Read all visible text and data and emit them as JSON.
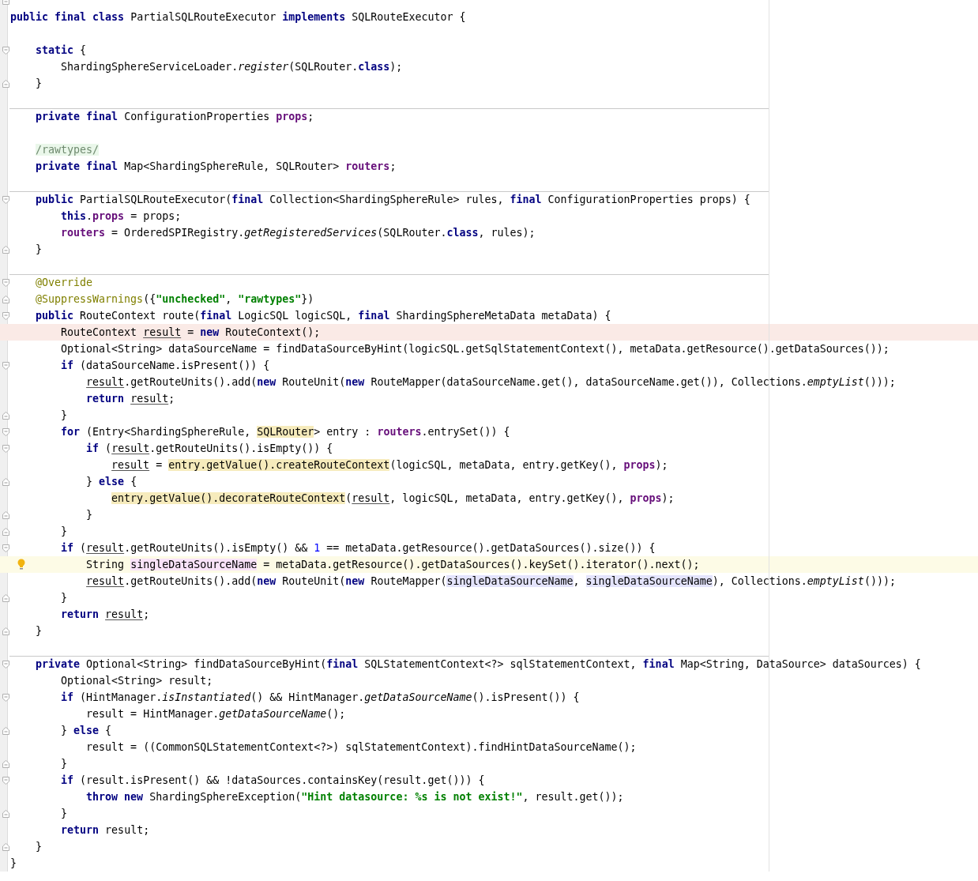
{
  "editor": {
    "lines": [
      {
        "kind": "blank",
        "fold_end": true
      },
      {
        "kind": "code",
        "tokens": [
          {
            "kind": "keyword",
            "text": "public final class"
          },
          {
            "kind": "plain",
            "text": " PartialSQLRouteExecutor "
          },
          {
            "kind": "keyword",
            "text": "implements"
          },
          {
            "kind": "plain",
            "text": " SQLRouteExecutor {"
          }
        ]
      },
      {
        "kind": "blank"
      },
      {
        "kind": "code",
        "fold_start": true,
        "tokens": [
          {
            "kind": "keyword",
            "text": "    static"
          },
          {
            "kind": "plain",
            "text": " {"
          }
        ]
      },
      {
        "kind": "code",
        "tokens": [
          {
            "kind": "plain",
            "text": "        ShardingSphereServiceLoader."
          },
          {
            "kind": "static",
            "text": "register"
          },
          {
            "kind": "plain",
            "text": "(SQLRouter."
          },
          {
            "kind": "keyword",
            "text": "class"
          },
          {
            "kind": "plain",
            "text": ");"
          }
        ]
      },
      {
        "kind": "code",
        "fold_end": true,
        "tokens": [
          {
            "kind": "plain",
            "text": "    }"
          }
        ]
      },
      {
        "kind": "blank"
      },
      {
        "kind": "code",
        "separator": true,
        "tokens": [
          {
            "kind": "keyword",
            "text": "    private final"
          },
          {
            "kind": "plain",
            "text": " ConfigurationProperties "
          },
          {
            "kind": "field",
            "text": "props"
          },
          {
            "kind": "plain",
            "text": ";"
          }
        ]
      },
      {
        "kind": "blank"
      },
      {
        "kind": "code",
        "tokens": [
          {
            "kind": "comment",
            "text": "    /rawtypes/"
          }
        ]
      },
      {
        "kind": "code",
        "tokens": [
          {
            "kind": "keyword",
            "text": "    private final"
          },
          {
            "kind": "plain",
            "text": " Map<ShardingSphereRule, SQLRouter> "
          },
          {
            "kind": "field",
            "text": "routers"
          },
          {
            "kind": "plain",
            "text": ";"
          }
        ]
      },
      {
        "kind": "blank"
      },
      {
        "kind": "code",
        "separator": true,
        "fold_start": true,
        "tokens": [
          {
            "kind": "keyword",
            "text": "    public"
          },
          {
            "kind": "plain",
            "text": " PartialSQLRouteExecutor("
          },
          {
            "kind": "keyword",
            "text": "final"
          },
          {
            "kind": "plain",
            "text": " Collection<ShardingSphereRule> rules, "
          },
          {
            "kind": "keyword",
            "text": "final"
          },
          {
            "kind": "plain",
            "text": " ConfigurationProperties props) {"
          }
        ]
      },
      {
        "kind": "code",
        "tokens": [
          {
            "kind": "keyword",
            "text": "        this"
          },
          {
            "kind": "plain",
            "text": "."
          },
          {
            "kind": "field",
            "text": "props"
          },
          {
            "kind": "plain",
            "text": " = props;"
          }
        ]
      },
      {
        "kind": "code",
        "tokens": [
          {
            "kind": "field",
            "text": "        routers"
          },
          {
            "kind": "plain",
            "text": " = OrderedSPIRegistry."
          },
          {
            "kind": "static",
            "text": "getRegisteredServices"
          },
          {
            "kind": "plain",
            "text": "(SQLRouter."
          },
          {
            "kind": "keyword",
            "text": "class"
          },
          {
            "kind": "plain",
            "text": ", rules);"
          }
        ]
      },
      {
        "kind": "code",
        "fold_end": true,
        "tokens": [
          {
            "kind": "plain",
            "text": "    }"
          }
        ]
      },
      {
        "kind": "blank"
      },
      {
        "kind": "code",
        "separator": true,
        "fold_start": true,
        "tokens": [
          {
            "kind": "annotation",
            "text": "    @Override"
          }
        ]
      },
      {
        "kind": "code",
        "fold_end": true,
        "tokens": [
          {
            "kind": "annotation",
            "text": "    @SuppressWarnings"
          },
          {
            "kind": "plain",
            "text": "({"
          },
          {
            "kind": "string",
            "text": "\"unchecked\""
          },
          {
            "kind": "plain",
            "text": ", "
          },
          {
            "kind": "string",
            "text": "\"rawtypes\""
          },
          {
            "kind": "plain",
            "text": "})"
          }
        ]
      },
      {
        "kind": "code",
        "fold_start": true,
        "tokens": [
          {
            "kind": "keyword",
            "text": "    public"
          },
          {
            "kind": "plain",
            "text": " RouteContext route("
          },
          {
            "kind": "keyword",
            "text": "final"
          },
          {
            "kind": "plain",
            "text": " LogicSQL logicSQL, "
          },
          {
            "kind": "keyword",
            "text": "final"
          },
          {
            "kind": "plain",
            "text": " ShardingSphereMetaData metaData) {"
          }
        ]
      },
      {
        "kind": "code",
        "error_line": true,
        "tokens": [
          {
            "kind": "plain",
            "text": "        RouteContext "
          },
          {
            "kind": "reassigned",
            "text": "result"
          },
          {
            "kind": "plain",
            "text": " = "
          },
          {
            "kind": "keyword",
            "text": "new"
          },
          {
            "kind": "plain",
            "text": " RouteContext();"
          }
        ]
      },
      {
        "kind": "code",
        "tokens": [
          {
            "kind": "plain",
            "text": "        Optional<String> dataSourceName = findDataSourceByHint(logicSQL.getSqlStatementContext(), metaData.getResource().getDataSources());"
          }
        ]
      },
      {
        "kind": "code",
        "fold_start": true,
        "tokens": [
          {
            "kind": "keyword",
            "text": "        if"
          },
          {
            "kind": "plain",
            "text": " (dataSourceName.isPresent()) {"
          }
        ]
      },
      {
        "kind": "code",
        "tokens": [
          {
            "kind": "reassigned",
            "text": "            result"
          },
          {
            "kind": "plain",
            "text": ".getRouteUnits().add("
          },
          {
            "kind": "keyword",
            "text": "new"
          },
          {
            "kind": "plain",
            "text": " RouteUnit("
          },
          {
            "kind": "keyword",
            "text": "new"
          },
          {
            "kind": "plain",
            "text": " RouteMapper(dataSourceName.get(), dataSourceName.get()), Collections."
          },
          {
            "kind": "static",
            "text": "emptyList"
          },
          {
            "kind": "plain",
            "text": "()));"
          }
        ]
      },
      {
        "kind": "code",
        "tokens": [
          {
            "kind": "keyword",
            "text": "            return"
          },
          {
            "kind": "reassigned",
            "text": " result"
          },
          {
            "kind": "plain",
            "text": ";"
          }
        ]
      },
      {
        "kind": "code",
        "fold_end": true,
        "tokens": [
          {
            "kind": "plain",
            "text": "        }"
          }
        ]
      },
      {
        "kind": "code",
        "fold_start": true,
        "tokens": [
          {
            "kind": "keyword",
            "text": "        for"
          },
          {
            "kind": "plain",
            "text": " (Entry<ShardingSphereRule, "
          },
          {
            "kind": "plain",
            "text": "SQLRouter",
            "color": "#f6ebbc"
          },
          {
            "kind": "plain",
            "text": "> entry : "
          },
          {
            "kind": "field",
            "text": "routers"
          },
          {
            "kind": "plain",
            "text": ".entrySet()) {"
          }
        ]
      },
      {
        "kind": "code",
        "fold_start": true,
        "tokens": [
          {
            "kind": "keyword",
            "text": "            if"
          },
          {
            "kind": "plain",
            "text": " ("
          },
          {
            "kind": "reassigned",
            "text": "result"
          },
          {
            "kind": "plain",
            "text": ".getRouteUnits().isEmpty()) {"
          }
        ]
      },
      {
        "kind": "code",
        "tokens": [
          {
            "kind": "reassigned",
            "text": "                result"
          },
          {
            "kind": "plain",
            "text": " = "
          },
          {
            "kind": "plain",
            "text": "entry.getValue().createRouteContext",
            "color": "#f6ebbc"
          },
          {
            "kind": "plain",
            "text": "(logicSQL, metaData, entry.getKey(), "
          },
          {
            "kind": "field",
            "text": "props"
          },
          {
            "kind": "plain",
            "text": ");"
          }
        ]
      },
      {
        "kind": "code",
        "fold_end": true,
        "tokens": [
          {
            "kind": "plain",
            "text": "            } "
          },
          {
            "kind": "keyword",
            "text": "else"
          },
          {
            "kind": "plain",
            "text": " {"
          }
        ]
      },
      {
        "kind": "code",
        "tokens": [
          {
            "kind": "plain",
            "text": "                entry.getValue().decorateRouteContext",
            "color": "#f6ebbc"
          },
          {
            "kind": "plain",
            "text": "("
          },
          {
            "kind": "reassigned",
            "text": "result"
          },
          {
            "kind": "plain",
            "text": ", logicSQL, metaData, entry.getKey(), "
          },
          {
            "kind": "field",
            "text": "props"
          },
          {
            "kind": "plain",
            "text": ");"
          }
        ]
      },
      {
        "kind": "code",
        "fold_end": true,
        "tokens": [
          {
            "kind": "plain",
            "text": "            }"
          }
        ]
      },
      {
        "kind": "code",
        "fold_end": true,
        "tokens": [
          {
            "kind": "plain",
            "text": "        }"
          }
        ]
      },
      {
        "kind": "code",
        "fold_start": true,
        "tokens": [
          {
            "kind": "keyword",
            "text": "        if"
          },
          {
            "kind": "plain",
            "text": " ("
          },
          {
            "kind": "reassigned",
            "text": "result"
          },
          {
            "kind": "plain",
            "text": ".getRouteUnits().isEmpty() && "
          },
          {
            "kind": "number",
            "text": "1"
          },
          {
            "kind": "plain",
            "text": " == metaData.getResource().getDataSources().size()) {"
          }
        ]
      },
      {
        "kind": "code",
        "caret_line": true,
        "bulb": true,
        "tokens": [
          {
            "kind": "plain",
            "text": "            String "
          },
          {
            "kind": "plain",
            "text": "singleDataSourceName",
            "color": "#f9e3f9"
          },
          {
            "kind": "plain",
            "text": " = metaData.getResource().getDataSources().keySet().iterator().next();"
          }
        ]
      },
      {
        "kind": "code",
        "tokens": [
          {
            "kind": "reassigned",
            "text": "            result"
          },
          {
            "kind": "plain",
            "text": ".getRouteUnits().add("
          },
          {
            "kind": "keyword",
            "text": "new"
          },
          {
            "kind": "plain",
            "text": " RouteUnit("
          },
          {
            "kind": "keyword",
            "text": "new"
          },
          {
            "kind": "plain",
            "text": " RouteMapper("
          },
          {
            "kind": "plain",
            "text": "singleDataSourceName",
            "color": "#e4e4fc"
          },
          {
            "kind": "plain",
            "text": ", "
          },
          {
            "kind": "plain",
            "text": "singleDataSourceName",
            "color": "#e4e4fc"
          },
          {
            "kind": "plain",
            "text": "), Collections."
          },
          {
            "kind": "static",
            "text": "emptyList"
          },
          {
            "kind": "plain",
            "text": "()));"
          }
        ]
      },
      {
        "kind": "code",
        "fold_end": true,
        "tokens": [
          {
            "kind": "plain",
            "text": "        }"
          }
        ]
      },
      {
        "kind": "code",
        "tokens": [
          {
            "kind": "keyword",
            "text": "        return"
          },
          {
            "kind": "reassigned",
            "text": " result"
          },
          {
            "kind": "plain",
            "text": ";"
          }
        ]
      },
      {
        "kind": "code",
        "fold_end": true,
        "tokens": [
          {
            "kind": "plain",
            "text": "    }"
          }
        ]
      },
      {
        "kind": "blank"
      },
      {
        "kind": "code",
        "separator": true,
        "fold_start": true,
        "tokens": [
          {
            "kind": "keyword",
            "text": "    private"
          },
          {
            "kind": "plain",
            "text": " Optional<String> findDataSourceByHint("
          },
          {
            "kind": "keyword",
            "text": "final"
          },
          {
            "kind": "plain",
            "text": " SQLStatementContext<?> sqlStatementContext, "
          },
          {
            "kind": "keyword",
            "text": "final"
          },
          {
            "kind": "plain",
            "text": " Map<String, DataSource> dataSources) {"
          }
        ]
      },
      {
        "kind": "code",
        "tokens": [
          {
            "kind": "plain",
            "text": "        Optional<String> result;"
          }
        ]
      },
      {
        "kind": "code",
        "fold_start": true,
        "tokens": [
          {
            "kind": "keyword",
            "text": "        if"
          },
          {
            "kind": "plain",
            "text": " (HintManager."
          },
          {
            "kind": "static",
            "text": "isInstantiated"
          },
          {
            "kind": "plain",
            "text": "() && HintManager."
          },
          {
            "kind": "static",
            "text": "getDataSourceName"
          },
          {
            "kind": "plain",
            "text": "().isPresent()) {"
          }
        ]
      },
      {
        "kind": "code",
        "tokens": [
          {
            "kind": "plain",
            "text": "            result = HintManager."
          },
          {
            "kind": "static",
            "text": "getDataSourceName"
          },
          {
            "kind": "plain",
            "text": "();"
          }
        ]
      },
      {
        "kind": "code",
        "fold_end": true,
        "tokens": [
          {
            "kind": "plain",
            "text": "        } "
          },
          {
            "kind": "keyword",
            "text": "else"
          },
          {
            "kind": "plain",
            "text": " {"
          }
        ]
      },
      {
        "kind": "code",
        "tokens": [
          {
            "kind": "plain",
            "text": "            result = ((CommonSQLStatementContext<?>) sqlStatementContext).findHintDataSourceName();"
          }
        ]
      },
      {
        "kind": "code",
        "fold_end": true,
        "tokens": [
          {
            "kind": "plain",
            "text": "        }"
          }
        ]
      },
      {
        "kind": "code",
        "fold_start": true,
        "tokens": [
          {
            "kind": "keyword",
            "text": "        if"
          },
          {
            "kind": "plain",
            "text": " (result.isPresent() && !dataSources.containsKey(result.get())) {"
          }
        ]
      },
      {
        "kind": "code",
        "tokens": [
          {
            "kind": "keyword",
            "text": "            throw new"
          },
          {
            "kind": "plain",
            "text": " ShardingSphereException("
          },
          {
            "kind": "string",
            "text": "\"Hint datasource: %s is not exist!\""
          },
          {
            "kind": "plain",
            "text": ", result.get());"
          }
        ]
      },
      {
        "kind": "code",
        "fold_end": true,
        "tokens": [
          {
            "kind": "plain",
            "text": "        }"
          }
        ]
      },
      {
        "kind": "code",
        "tokens": [
          {
            "kind": "keyword",
            "text": "        return"
          },
          {
            "kind": "plain",
            "text": " result;"
          }
        ]
      },
      {
        "kind": "code",
        "fold_end": true,
        "tokens": [
          {
            "kind": "plain",
            "text": "    }"
          }
        ]
      },
      {
        "kind": "code",
        "tokens": [
          {
            "kind": "plain",
            "text": "}"
          }
        ]
      }
    ]
  }
}
